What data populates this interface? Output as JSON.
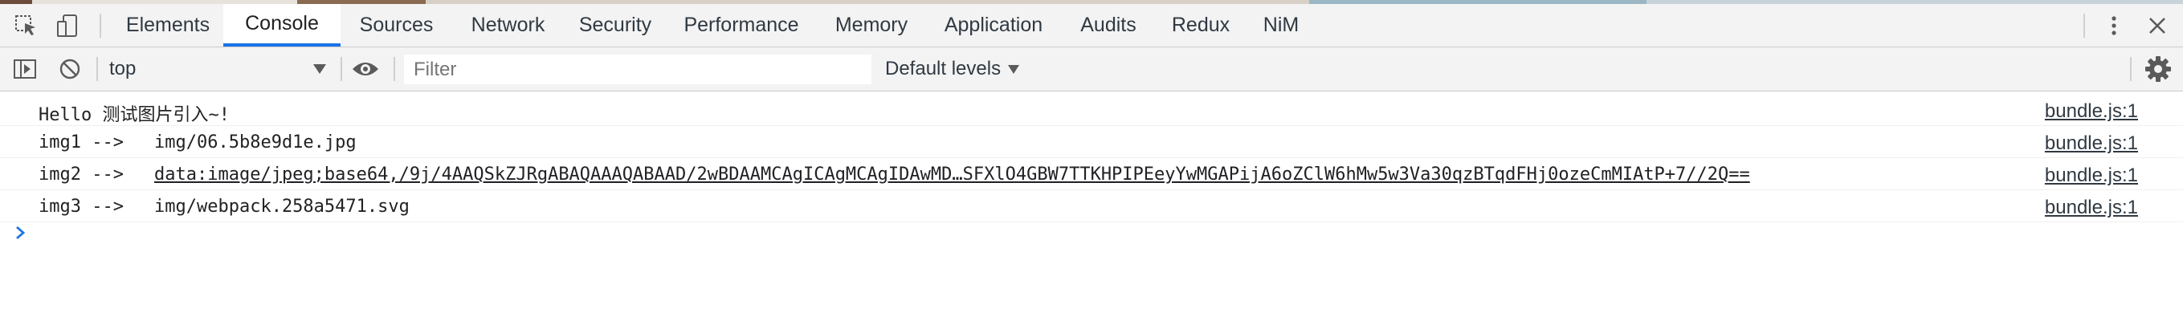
{
  "tabs": [
    {
      "label": "Elements",
      "active": false
    },
    {
      "label": "Console",
      "active": true
    },
    {
      "label": "Sources",
      "active": false
    },
    {
      "label": "Network",
      "active": false
    },
    {
      "label": "Security",
      "active": false
    },
    {
      "label": "Performance",
      "active": false
    },
    {
      "label": "Memory",
      "active": false
    },
    {
      "label": "Application",
      "active": false
    },
    {
      "label": "Audits",
      "active": false
    },
    {
      "label": "Redux",
      "active": false
    },
    {
      "label": "NiM",
      "active": false
    }
  ],
  "toolbar": {
    "context": "top",
    "filter_placeholder": "Filter",
    "levels_label": "Default levels"
  },
  "messages": [
    {
      "text": "Hello 测试图片引入~!",
      "value": "",
      "value_is_link": false,
      "source": "bundle.js:1"
    },
    {
      "text": "img1 -->",
      "value": "img/06.5b8e9d1e.jpg",
      "value_is_link": false,
      "source": "bundle.js:1"
    },
    {
      "text": "img2 -->",
      "value": "data:image/jpeg;base64,/9j/4AAQSkZJRgABAQAAAQABAAD/2wBDAAMCAgICAgMCAgIDAwMD…SFXlO4GBW7TTKHPIPEeyYwMGAPijA6oZClW6hMw5w3Va30qzBTqdFHj0ozeCmMIAtP+7//2Q==",
      "value_is_link": true,
      "source": "bundle.js:1"
    },
    {
      "text": "img3 -->",
      "value": "img/webpack.258a5471.svg",
      "value_is_link": false,
      "source": "bundle.js:1"
    }
  ],
  "colors": {
    "toolbar_bg": "#f3f3f3",
    "active_tab_underline": "#1a73e8",
    "prompt_chevron": "#1a73e8"
  }
}
